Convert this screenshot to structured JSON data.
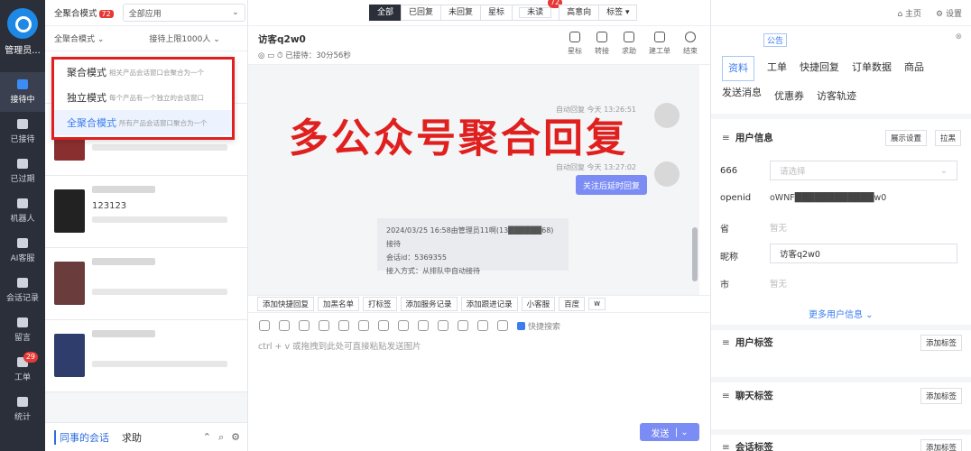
{
  "rail": {
    "brand": "管理员...",
    "items": [
      {
        "label": "接待中",
        "icon": "chat-active-icon",
        "active": true,
        "badge": ""
      },
      {
        "label": "已接待",
        "icon": "chat-done-icon",
        "badge": ""
      },
      {
        "label": "已过期",
        "icon": "expired-icon",
        "badge": ""
      },
      {
        "label": "机器人",
        "icon": "robot-icon",
        "badge": ""
      },
      {
        "label": "AI客服",
        "icon": "ai-service-icon",
        "badge": ""
      },
      {
        "label": "会话记录",
        "icon": "history-icon",
        "badge": ""
      },
      {
        "label": "留言",
        "icon": "message-icon",
        "badge": ""
      },
      {
        "label": "工单",
        "icon": "ticket-icon",
        "badge": "29"
      },
      {
        "label": "统计",
        "icon": "stats-icon",
        "badge": ""
      }
    ]
  },
  "conv": {
    "mode_label": "全聚合模式",
    "mode_badge": "72",
    "app_select": "全部应用",
    "mode_select": "全聚合模式",
    "limit_select": "接待上限1000人",
    "list": [
      {
        "line2": "",
        "time": "",
        "hidden": true
      },
      {
        "line2": "",
        "time": ""
      },
      {
        "line2": "",
        "time": ""
      },
      {
        "line2": "123123",
        "time": ""
      },
      {
        "line2": "",
        "time": ""
      },
      {
        "line2": "",
        "time": ""
      }
    ],
    "bottom_tab_active": "同事的会话",
    "bottom_tab_other": "求助"
  },
  "popup": {
    "options": [
      {
        "title": "聚合模式",
        "desc": "相关产品会话窗口会聚合为一个",
        "selected": false
      },
      {
        "title": "独立模式",
        "desc": "每个产品有一个独立的会话窗口",
        "selected": false
      },
      {
        "title": "全聚合模式",
        "desc": "所有产品会话窗口聚合为一个",
        "selected": true
      }
    ]
  },
  "chat": {
    "filters": [
      {
        "label": "全部",
        "active": true,
        "badge": ""
      },
      {
        "label": "已回复",
        "badge": ""
      },
      {
        "label": "未回复",
        "badge": ""
      },
      {
        "label": "星标",
        "badge": ""
      },
      {
        "label": "未读",
        "badge": "72"
      },
      {
        "label": "高意向",
        "badge": ""
      },
      {
        "label": "标签 ▾",
        "badge": ""
      }
    ],
    "title": "访客q2w0",
    "meta": "已接待：30分56秒",
    "tools": [
      "星标",
      "转接",
      "求助",
      "建工单",
      "结束"
    ],
    "overlay_text": "多公众号聚合回复",
    "msg1_meta": "自动回复  今天 13:26:51",
    "msg2_meta": "自动回复  今天 13:27:02",
    "msg2_text": "关注后延时回复",
    "sys_lines": [
      "2024/03/25 16:58由管理员11啊(13██████68)接待",
      "会话id：5369355",
      "接入方式：从排队中自动接待"
    ],
    "quick_actions": [
      "添加快捷回复",
      "加黑名单",
      "打标签",
      "添加服务记录",
      "添加跟进记录",
      "小客服",
      "百度",
      "w"
    ],
    "quick_search": "快捷搜索",
    "placeholder": "ctrl + v 或拖拽到此处可直接粘贴发送图片",
    "send": "发送"
  },
  "right": {
    "home": "主页",
    "settings": "设置",
    "notice": "公告",
    "tabs": [
      "资料",
      "工单",
      "快捷回复",
      "订单数据",
      "商品",
      "发送消息",
      "优惠券",
      "访客轨迹"
    ],
    "user_info_title": "用户信息",
    "show_settings": "展示设置",
    "pull": "拉黑",
    "fields": [
      {
        "label": "666",
        "value": "请选择",
        "type": "select"
      },
      {
        "label": "openid",
        "value": "oWNF████████████w0",
        "type": "text"
      },
      {
        "label": "省",
        "value": "暂无",
        "type": "muted"
      },
      {
        "label": "昵称",
        "value": "访客q2w0",
        "type": "input"
      },
      {
        "label": "市",
        "value": "暂无",
        "type": "muted"
      }
    ],
    "more": "更多用户信息 ⌄",
    "user_tags": "用户标签",
    "chat_tags": "聊天标签",
    "conv_tags": "会话标签",
    "add_tag": "添加标签"
  }
}
